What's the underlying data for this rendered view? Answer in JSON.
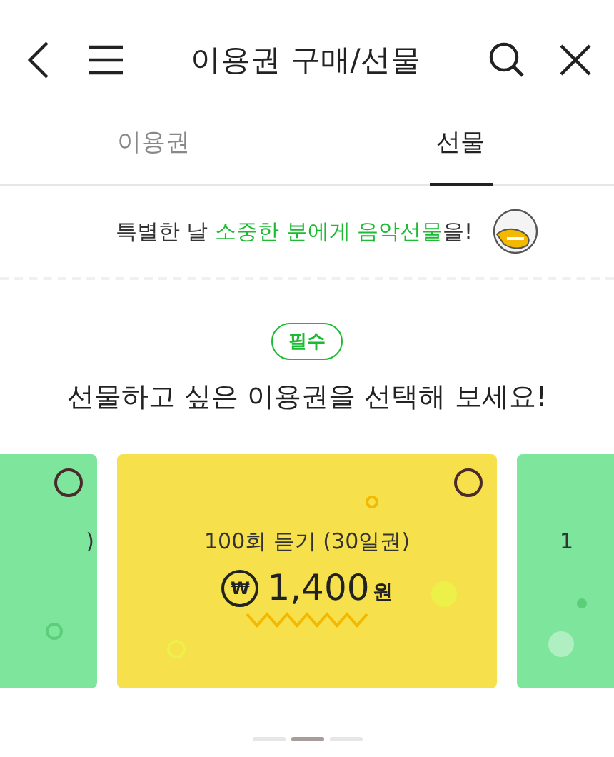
{
  "header": {
    "title": "이용권 구매/선물"
  },
  "tabs": [
    {
      "label": "이용권",
      "selected": false
    },
    {
      "label": "선물",
      "selected": true
    }
  ],
  "banner": {
    "text": "특별한 날 **소중한 분에게 음악선물**을!"
  },
  "badge": "필수",
  "heading": "선물하고 싶은 이용권을 선택해 보세요!",
  "cards": [
    {
      "title": ")",
      "color": "#7ee59c",
      "selected": false
    },
    {
      "title": "100회 듣기 (30일권)",
      "currency_symbol": "₩",
      "price": "1,400",
      "unit": "원",
      "color": "#f6e04b",
      "selected": false
    },
    {
      "title": "1",
      "color": "#7ee59c"
    }
  ],
  "pager": [
    {
      "selected": false
    },
    {
      "selected": true
    },
    {
      "selected": false
    }
  ]
}
